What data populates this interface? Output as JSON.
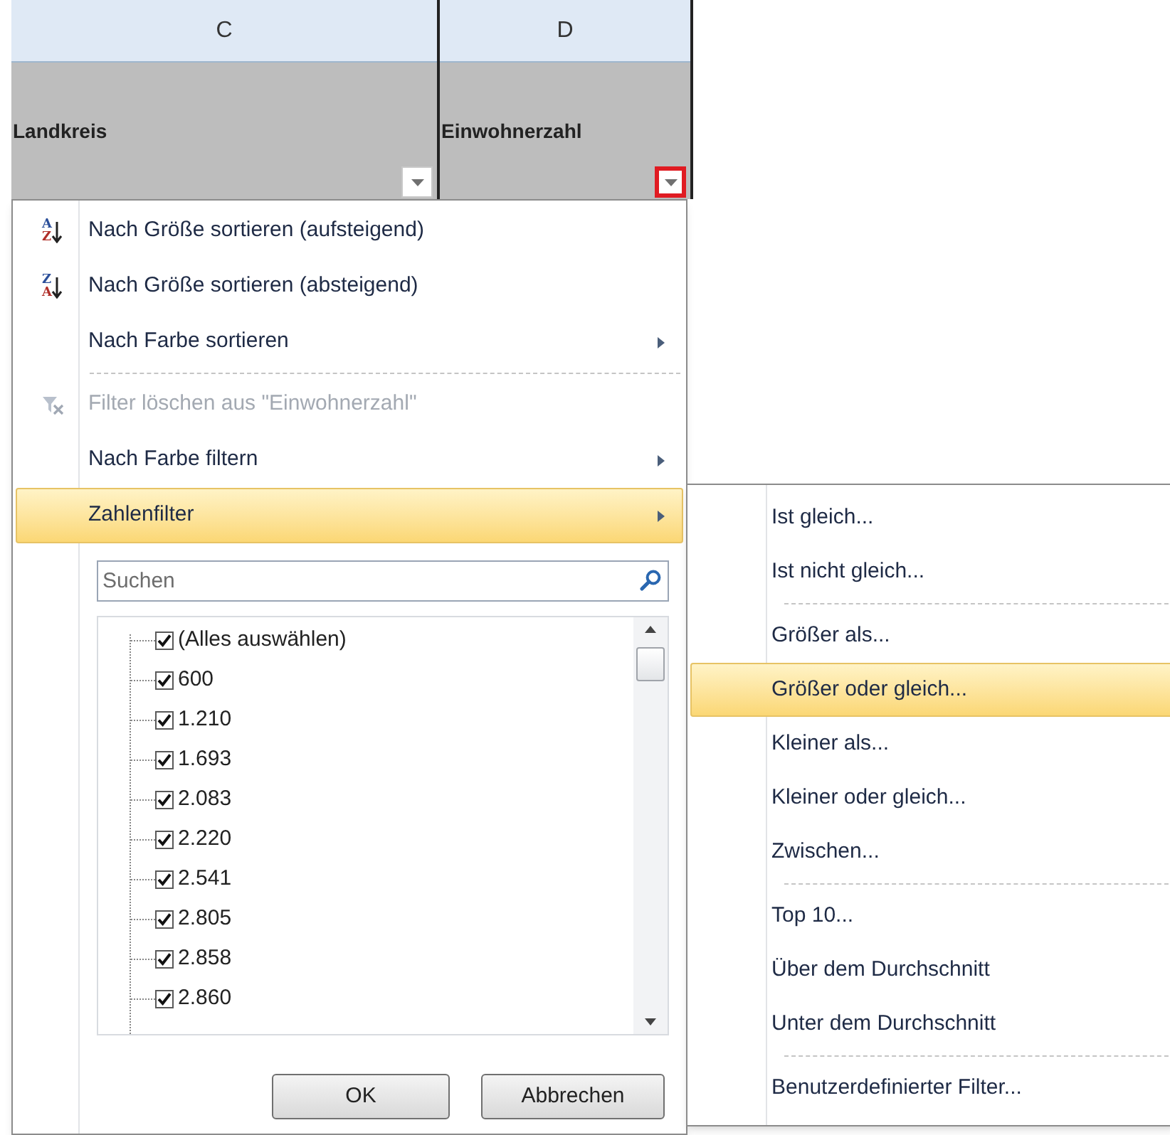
{
  "columns": [
    {
      "letter": "C",
      "header": "Landkreis",
      "filter_highlighted": false
    },
    {
      "letter": "D",
      "header": "Einwohnerzahl",
      "filter_highlighted": true
    }
  ],
  "menu": {
    "items": [
      {
        "kind": "sort",
        "icon_top": "A",
        "icon_bottom": "Z",
        "label": "Nach Größe sortieren (aufsteigend)",
        "disabled": false,
        "submenu": false,
        "selected": false
      },
      {
        "kind": "sort",
        "icon_top": "Z",
        "icon_bottom": "A",
        "label": "Nach Größe sortieren (absteigend)",
        "disabled": false,
        "submenu": false,
        "selected": false
      },
      {
        "kind": "item",
        "label": "Nach Farbe sortieren",
        "disabled": false,
        "submenu": true,
        "selected": false
      },
      {
        "kind": "separator"
      },
      {
        "kind": "clear",
        "label": "Filter löschen aus \"Einwohnerzahl\"",
        "disabled": true,
        "submenu": false,
        "selected": false
      },
      {
        "kind": "item",
        "label": "Nach Farbe filtern",
        "disabled": false,
        "submenu": true,
        "selected": false
      },
      {
        "kind": "item",
        "label": "Zahlenfilter",
        "disabled": false,
        "submenu": true,
        "selected": true
      }
    ],
    "search": {
      "placeholder": "Suchen"
    },
    "values": [
      {
        "label": "(Alles auswählen)",
        "checked": true
      },
      {
        "label": "600",
        "checked": true
      },
      {
        "label": "1.210",
        "checked": true
      },
      {
        "label": "1.693",
        "checked": true
      },
      {
        "label": "2.083",
        "checked": true
      },
      {
        "label": "2.220",
        "checked": true
      },
      {
        "label": "2.541",
        "checked": true
      },
      {
        "label": "2.805",
        "checked": true
      },
      {
        "label": "2.858",
        "checked": true
      },
      {
        "label": "2.860",
        "checked": true
      }
    ],
    "buttons": [
      "OK",
      "Abbrechen"
    ]
  },
  "submenu": {
    "items": [
      {
        "kind": "item",
        "label": "Ist gleich...",
        "selected": false
      },
      {
        "kind": "item",
        "label": "Ist nicht gleich...",
        "selected": false
      },
      {
        "kind": "separator"
      },
      {
        "kind": "item",
        "label": "Größer als...",
        "selected": false
      },
      {
        "kind": "item",
        "label": "Größer oder gleich...",
        "selected": true
      },
      {
        "kind": "item",
        "label": "Kleiner als...",
        "selected": false
      },
      {
        "kind": "item",
        "label": "Kleiner oder gleich...",
        "selected": false
      },
      {
        "kind": "item",
        "label": "Zwischen...",
        "selected": false
      },
      {
        "kind": "separator"
      },
      {
        "kind": "item",
        "label": "Top 10...",
        "selected": false
      },
      {
        "kind": "item",
        "label": "Über dem Durchschnitt",
        "selected": false
      },
      {
        "kind": "item",
        "label": "Unter dem Durchschnitt",
        "selected": false
      },
      {
        "kind": "separator"
      },
      {
        "kind": "item",
        "label": "Benutzerdefinierter Filter...",
        "selected": false
      }
    ]
  }
}
